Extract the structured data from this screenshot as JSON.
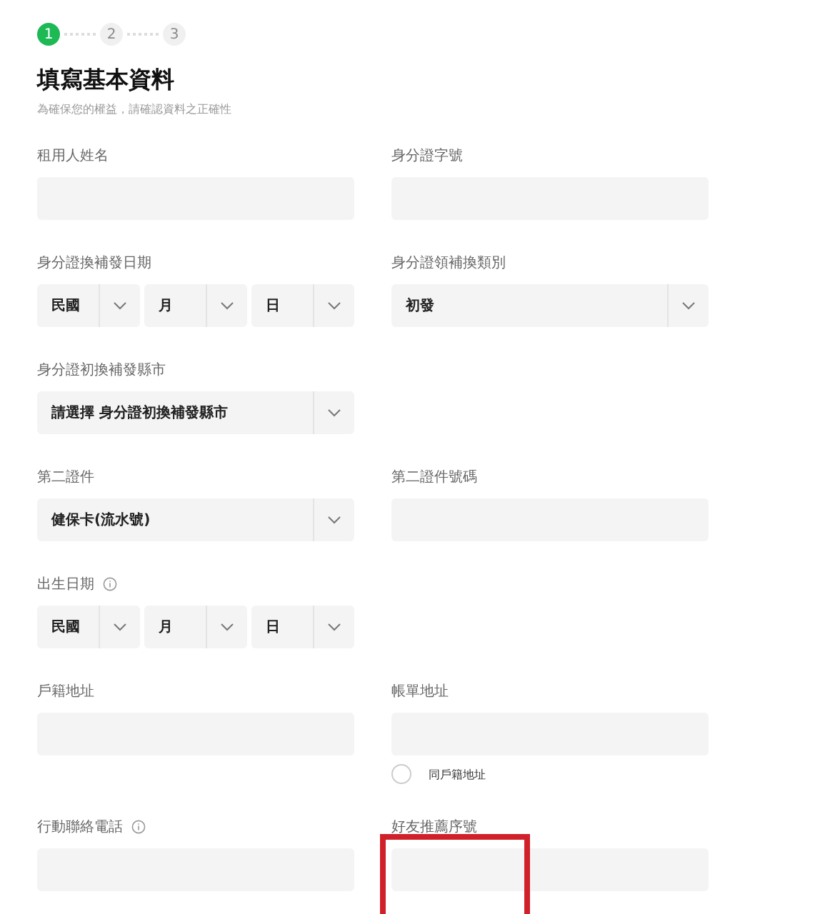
{
  "stepper": [
    {
      "label": "1",
      "selected": true
    },
    {
      "label": "2",
      "selected": false
    },
    {
      "label": "3",
      "selected": false
    }
  ],
  "title": "填寫基本資料",
  "subtitle": "為確保您的權益，請確認資料之正確性",
  "rows": [
    [
      {
        "label": "租用人姓名",
        "kind": "text"
      },
      {
        "label": "身分證字號",
        "kind": "text"
      }
    ],
    [
      {
        "label": "身分證換補發日期",
        "kind": "date",
        "parts": [
          "民國",
          "月",
          "日"
        ]
      },
      {
        "label": "身分證領補換類別",
        "kind": "select",
        "value": "初發"
      }
    ],
    [
      {
        "label": "身分證初換補發縣市",
        "kind": "select",
        "value": "請選擇 身分證初換補發縣市"
      }
    ],
    [
      {
        "label": "第二證件",
        "kind": "select",
        "value": "健保卡(流水號)"
      },
      {
        "label": "第二證件號碼",
        "kind": "text"
      }
    ],
    [
      {
        "label": "出生日期",
        "info": true,
        "kind": "date",
        "parts": [
          "民國",
          "月",
          "日"
        ]
      }
    ],
    [
      {
        "label": "戶籍地址",
        "kind": "text"
      },
      {
        "label": "帳單地址",
        "kind": "text",
        "option": {
          "label": "同戶籍地址",
          "checked": false
        }
      }
    ],
    [
      {
        "label": "行動聯絡電話",
        "info": true,
        "kind": "text"
      },
      {
        "label": "好友推薦序號",
        "kind": "text",
        "highlighted": true
      }
    ]
  ]
}
